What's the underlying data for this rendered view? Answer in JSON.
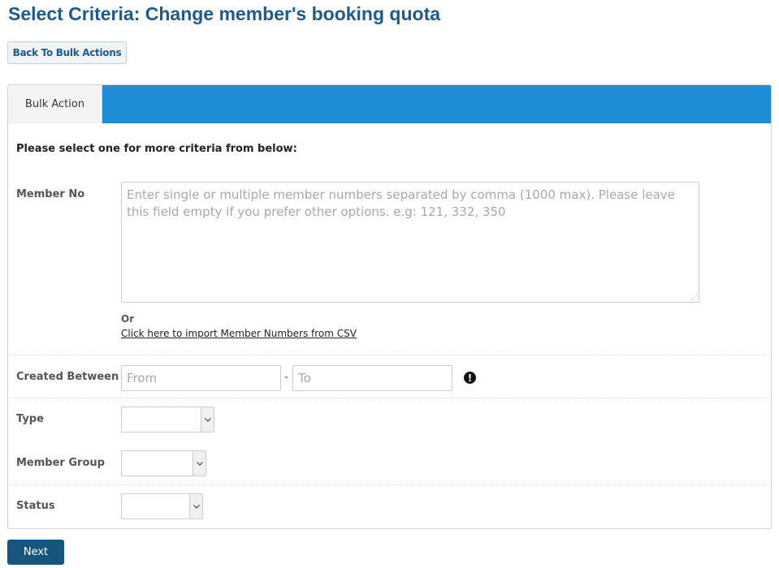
{
  "page": {
    "title": "Select Criteria: Change member's booking quota",
    "back_label": "Back To Bulk Actions",
    "next_label": "Next"
  },
  "panel": {
    "tab_label": "Bulk Action",
    "instruction": "Please select one for more criteria from below:",
    "header_color": "#1f8dd6"
  },
  "form": {
    "member_no": {
      "label": "Member No",
      "value": "",
      "placeholder": "Enter single or multiple member numbers separated by comma (1000 max). Please leave this field empty if you prefer other options. e.g: 121, 332, 350"
    },
    "or_text": "Or",
    "csv_link": "Click here to import Member Numbers from CSV",
    "created_between": {
      "label": "Created Between",
      "from_value": "",
      "from_placeholder": "From",
      "separator": "-",
      "to_value": "",
      "to_placeholder": "To",
      "info_icon": "exclamation-circle-icon"
    },
    "type": {
      "label": "Type",
      "selected": ""
    },
    "member_group": {
      "label": "Member Group",
      "selected": ""
    },
    "status": {
      "label": "Status",
      "selected": ""
    }
  }
}
